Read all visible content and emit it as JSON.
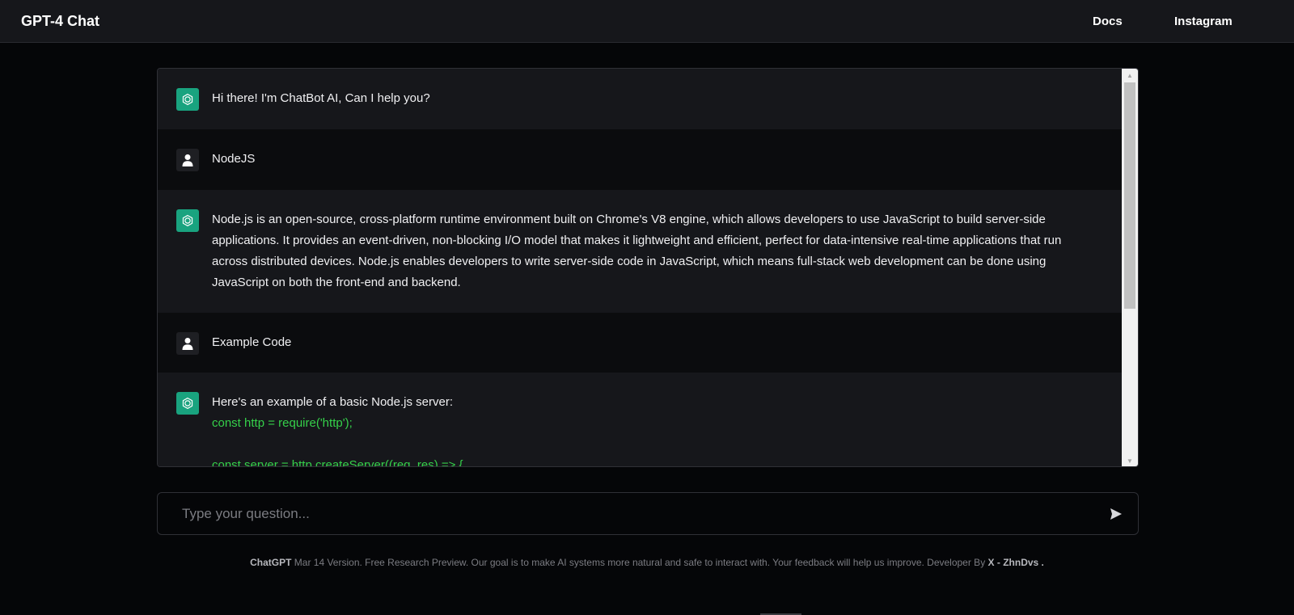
{
  "header": {
    "brand": "GPT-4 Chat",
    "nav": [
      "Docs",
      "Instagram"
    ]
  },
  "messages": [
    {
      "role": "bot",
      "icon": "openai-logo-icon",
      "text": "Hi there! I'm ChatBot AI, Can I help you?"
    },
    {
      "role": "user",
      "icon": "user-icon",
      "text": "NodeJS"
    },
    {
      "role": "bot",
      "icon": "openai-logo-icon",
      "text": "Node.js is an open-source, cross-platform runtime environment built on Chrome's V8 engine, which allows developers to use JavaScript to build server-side applications. It provides an event-driven, non-blocking I/O model that makes it lightweight and efficient, perfect for data-intensive real-time applications that run across distributed devices. Node.js enables developers to write server-side code in JavaScript, which means full-stack web development can be done using JavaScript on both the front-end and backend."
    },
    {
      "role": "user",
      "icon": "user-icon",
      "text": "Example Code"
    },
    {
      "role": "bot",
      "icon": "openai-logo-icon",
      "text": "Here's an example of a basic Node.js server:",
      "code": [
        "const http = require('http');",
        "",
        "const server = http.createServer((req, res) => {"
      ]
    }
  ],
  "composer": {
    "placeholder": "Type your question...",
    "value": "",
    "send_icon": "send-icon"
  },
  "footer": {
    "brand": "ChatGPT",
    "text": " Mar 14 Version. Free Research Preview. Our goal is to make AI systems more natural and safe to interact with. Your feedback will help us improve. Developer By ",
    "developer": "X - ZhnDvs",
    "end": " ."
  },
  "colors": {
    "accent": "#19a37f",
    "code": "#35d04a",
    "background": "#050608",
    "panel": "#16171b"
  }
}
